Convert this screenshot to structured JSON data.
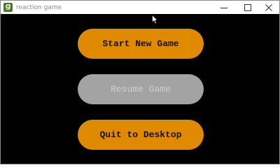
{
  "window": {
    "title": "reaction game",
    "icon_glyph": "g",
    "icon_name": "app-icon",
    "controls": [
      "minimize-icon",
      "maximize-icon",
      "close-icon"
    ]
  },
  "menu": {
    "start_label": "Start New Game",
    "resume_label": "Resume Game",
    "quit_label": "Quit to Desktop",
    "resume_enabled": false
  },
  "colors": {
    "background": "#000000",
    "button_active": "#e08a00",
    "button_disabled": "#a3a3a3",
    "button_text_active": "#111111",
    "button_text_disabled": "#cfcfcf"
  }
}
